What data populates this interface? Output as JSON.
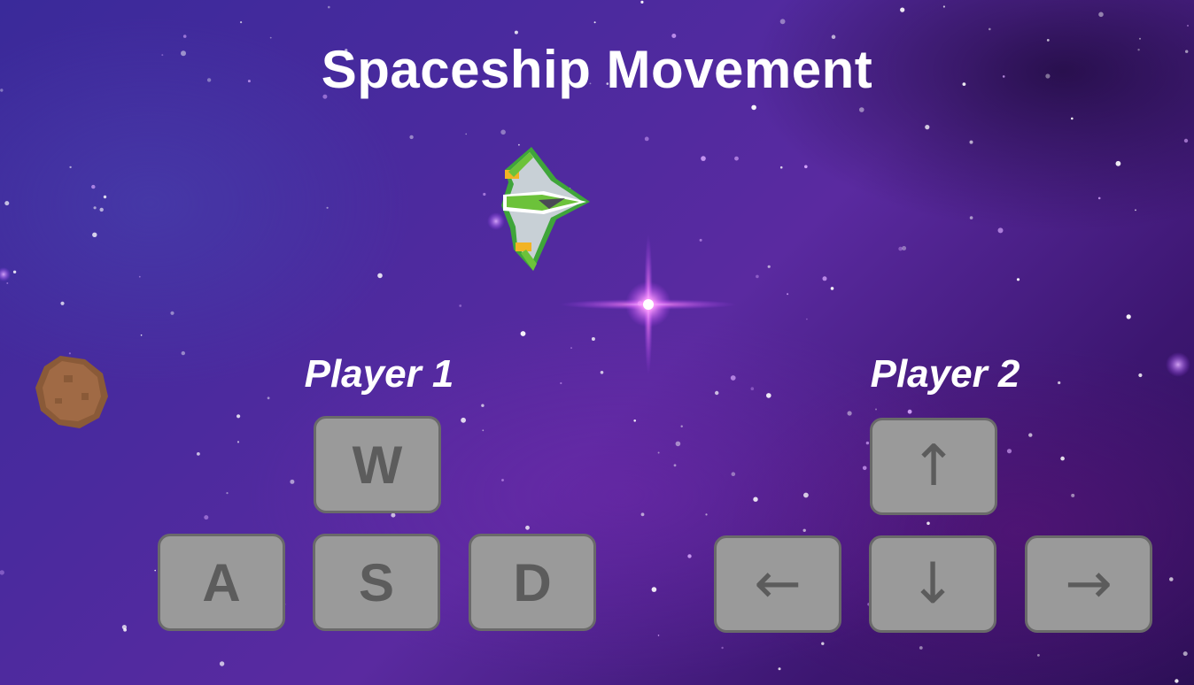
{
  "title": "Spaceship Movement",
  "player1": {
    "label": "Player 1",
    "keys": {
      "up": "W",
      "left": "A",
      "down": "S",
      "right": "D"
    }
  },
  "player2": {
    "label": "Player 2",
    "keys": {
      "up": "↑",
      "left": "←",
      "down": "↓",
      "right": "→"
    }
  },
  "colors": {
    "key_fill": "#9a9a9a",
    "key_border": "#6a6a6a",
    "key_text": "#5c5c5c",
    "text": "#ffffff"
  },
  "sprites": [
    "spaceship-icon",
    "asteroid-icon",
    "bright-star-icon"
  ]
}
